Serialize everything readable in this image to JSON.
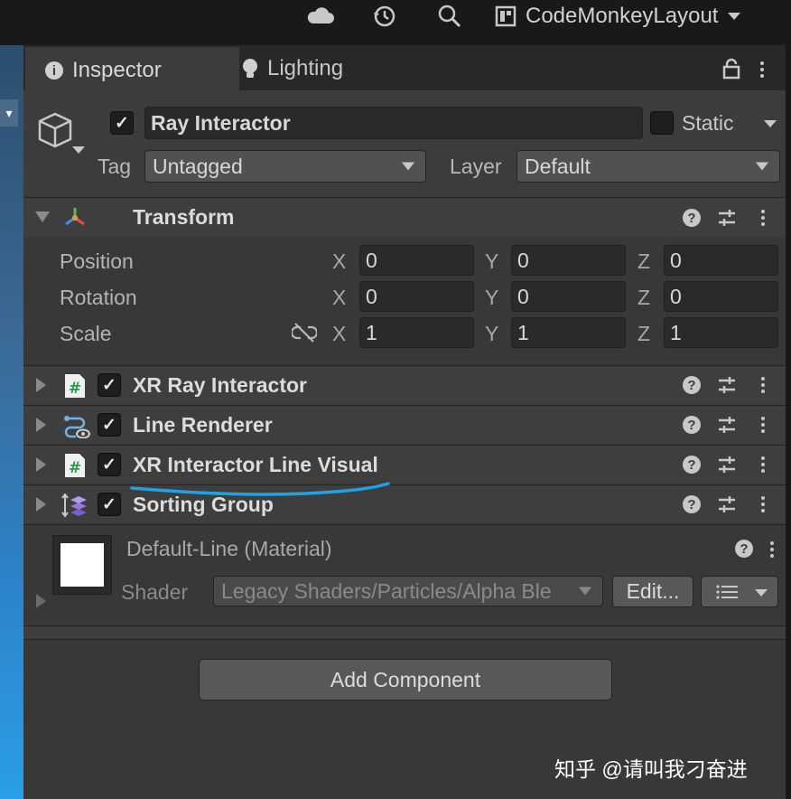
{
  "toolbar": {
    "icons": [
      "cloud-icon",
      "history-icon",
      "search-icon",
      "layout-icon",
      "chevron-down-icon"
    ],
    "layout_label": "CodeMonkeyLayout"
  },
  "tabs": [
    {
      "label": "Inspector",
      "icon": "info-icon",
      "active": true
    },
    {
      "label": "Lighting",
      "icon": "bulb-icon",
      "active": false
    }
  ],
  "gameobject": {
    "name": "Ray Interactor",
    "active": true,
    "static_label": "Static",
    "static": false,
    "tag_label": "Tag",
    "tag_value": "Untagged",
    "layer_label": "Layer",
    "layer_value": "Default"
  },
  "transform": {
    "title": "Transform",
    "rows": [
      {
        "label": "Position",
        "x": "0",
        "y": "0",
        "z": "0"
      },
      {
        "label": "Rotation",
        "x": "0",
        "y": "0",
        "z": "0"
      },
      {
        "label": "Scale",
        "x": "1",
        "y": "1",
        "z": "1"
      }
    ],
    "axes": [
      "X",
      "Y",
      "Z"
    ]
  },
  "components": [
    {
      "name": "XR Ray Interactor",
      "icon": "script-icon",
      "enabled": true
    },
    {
      "name": "Line Renderer",
      "icon": "line-renderer-icon",
      "enabled": true
    },
    {
      "name": "XR Interactor Line Visual",
      "icon": "script-icon",
      "enabled": true
    },
    {
      "name": "Sorting Group",
      "icon": "sorting-group-icon",
      "enabled": true
    }
  ],
  "material": {
    "name": "Default-Line (Material)",
    "shader_label": "Shader",
    "shader_value": "Legacy Shaders/Particles/Alpha Ble",
    "edit_label": "Edit..."
  },
  "add_component_label": "Add Component",
  "watermark": "知乎 @请叫我刁奋进",
  "colors": {
    "annotation_underline": "#1fa3e6",
    "panel_bg": "#383838",
    "header_bg": "#3c3c3c"
  }
}
